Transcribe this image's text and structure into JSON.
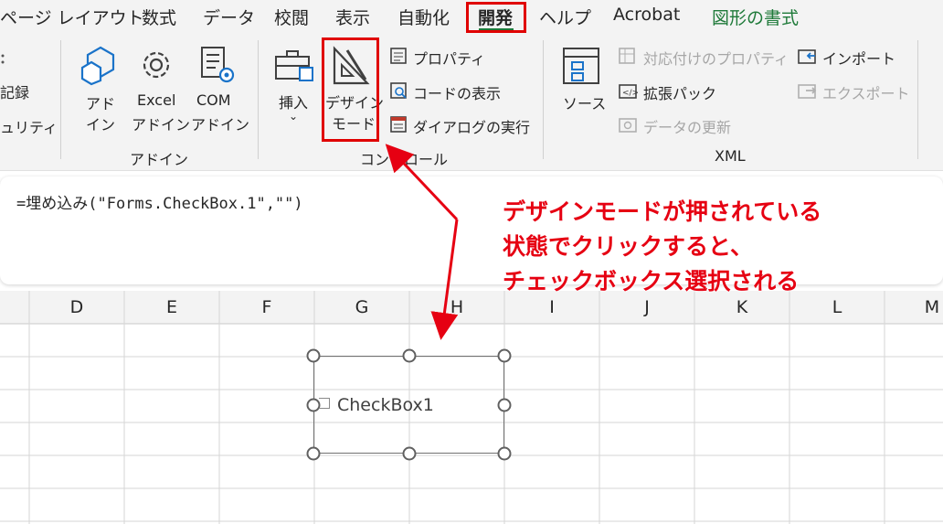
{
  "tabs": [
    {
      "label": "ページ レイアウト"
    },
    {
      "label": "数式"
    },
    {
      "label": "データ"
    },
    {
      "label": "校閲"
    },
    {
      "label": "表示"
    },
    {
      "label": "自動化"
    },
    {
      "label": "開発"
    },
    {
      "label": "ヘルプ"
    },
    {
      "label": "Acrobat"
    },
    {
      "label": "図形の書式"
    }
  ],
  "ribbon": {
    "code_group": {
      "record_label": "記録",
      "security_label": "ュリティ"
    },
    "addins_group": {
      "name": "アドイン",
      "addins_line1": "アド",
      "addins_line2": "イン",
      "excel_line1": "Excel",
      "excel_line2": "アドイン",
      "com_line1": "COM",
      "com_line2": "アドイン"
    },
    "controls_group": {
      "name": "コントロール",
      "insert_label": "挿入",
      "design_line1": "デザイン",
      "design_line2": "モード",
      "properties_label": "プロパティ",
      "view_code_label": "コードの表示",
      "run_dialog_label": "ダイアログの実行"
    },
    "xml_group": {
      "name": "XML",
      "source_label": "ソース",
      "map_properties_label": "対応付けのプロパティ",
      "expansion_packs_label": "拡張パック",
      "refresh_data_label": "データの更新",
      "import_label": "インポート",
      "export_label": "エクスポート"
    }
  },
  "formula_bar": {
    "text": "=埋め込み(\"Forms.CheckBox.1\",\"\")"
  },
  "annotation": {
    "line1": "デザインモードが押されている",
    "line2": "状態でクリックすると、",
    "line3": "チェックボックス選択される"
  },
  "columns": [
    "D",
    "E",
    "F",
    "G",
    "H",
    "I",
    "J",
    "K",
    "L",
    "M"
  ],
  "checkbox": {
    "label": "CheckBox1"
  },
  "colors": {
    "highlight": "#e00000",
    "accent_green": "#1f7a3a",
    "annotation": "#e60012"
  }
}
